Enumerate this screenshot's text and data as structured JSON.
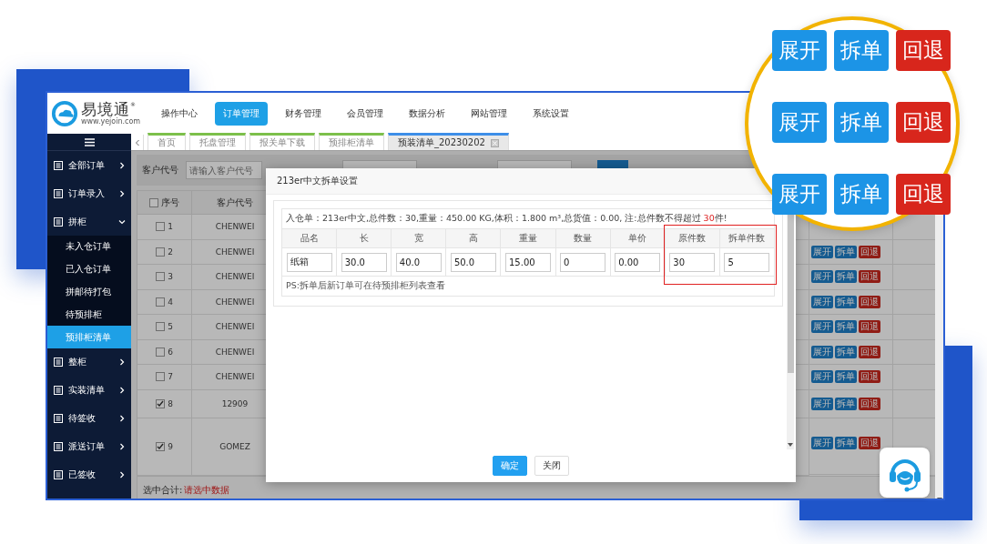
{
  "brand": {
    "name": "易境通",
    "mark": "®",
    "url": "www.yejoin.com"
  },
  "nav": [
    {
      "label": "操作中心",
      "selected": false
    },
    {
      "label": "订单管理",
      "selected": true
    },
    {
      "label": "财务管理",
      "selected": false
    },
    {
      "label": "会员管理",
      "selected": false
    },
    {
      "label": "数据分析",
      "selected": false
    },
    {
      "label": "网站管理",
      "selected": false
    },
    {
      "label": "系统设置",
      "selected": false
    }
  ],
  "sidebar": {
    "items": [
      {
        "label": "全部订单",
        "expanded": false
      },
      {
        "label": "订单录入",
        "expanded": false
      },
      {
        "label": "拼柜",
        "expanded": true,
        "children": [
          {
            "label": "未入仓订单",
            "selected": false
          },
          {
            "label": "已入仓订单",
            "selected": false
          },
          {
            "label": "拼邮待打包",
            "selected": false
          },
          {
            "label": "待预排柜",
            "selected": false
          },
          {
            "label": "预排柜清单",
            "selected": true
          }
        ]
      },
      {
        "label": "整柜",
        "expanded": false
      },
      {
        "label": "实装清单",
        "expanded": false
      },
      {
        "label": "待签收",
        "expanded": false
      },
      {
        "label": "派送订单",
        "expanded": false
      },
      {
        "label": "已签收",
        "expanded": false
      }
    ]
  },
  "tabs": [
    {
      "label": "首页",
      "selected": false,
      "closable": false
    },
    {
      "label": "托盘管理",
      "selected": false,
      "closable": false
    },
    {
      "label": "报关单下载",
      "selected": false,
      "closable": false
    },
    {
      "label": "预排柜清单",
      "selected": false,
      "closable": false
    },
    {
      "label": "预装清单_20230202",
      "selected": true,
      "closable": true
    }
  ],
  "filter": {
    "label": "客户代号",
    "placeholder": "请输入客户代号"
  },
  "table": {
    "columns": [
      "序号",
      "客户代号"
    ],
    "all_checked": false,
    "rows": [
      {
        "index": "1",
        "customer": "CHENWEI",
        "checked": false
      },
      {
        "index": "2",
        "customer": "CHENWEI",
        "checked": false,
        "actions": [
          {
            "label": "展开",
            "kind": "primary"
          },
          {
            "label": "拆单",
            "kind": "primary"
          },
          {
            "label": "回退",
            "kind": "danger"
          }
        ]
      },
      {
        "index": "3",
        "customer": "CHENWEI",
        "checked": false,
        "actions": [
          {
            "label": "展开",
            "kind": "primary"
          },
          {
            "label": "拆单",
            "kind": "primary"
          },
          {
            "label": "回退",
            "kind": "danger"
          }
        ]
      },
      {
        "index": "4",
        "customer": "CHENWEI",
        "checked": false,
        "actions": [
          {
            "label": "展开",
            "kind": "primary"
          },
          {
            "label": "拆单",
            "kind": "primary"
          },
          {
            "label": "回退",
            "kind": "danger"
          }
        ]
      },
      {
        "index": "5",
        "customer": "CHENWEI",
        "checked": false,
        "actions": [
          {
            "label": "展开",
            "kind": "primary"
          },
          {
            "label": "拆单",
            "kind": "primary"
          },
          {
            "label": "回退",
            "kind": "danger"
          }
        ]
      },
      {
        "index": "6",
        "customer": "CHENWEI",
        "checked": false,
        "actions": [
          {
            "label": "展开",
            "kind": "primary"
          },
          {
            "label": "拆单",
            "kind": "primary"
          },
          {
            "label": "回退",
            "kind": "danger"
          }
        ]
      },
      {
        "index": "7",
        "customer": "CHENWEI",
        "checked": false,
        "actions": [
          {
            "label": "展开",
            "kind": "primary"
          },
          {
            "label": "拆单",
            "kind": "primary"
          },
          {
            "label": "回退",
            "kind": "danger"
          }
        ]
      },
      {
        "index": "8",
        "customer": "12909",
        "checked": true,
        "actions": [
          {
            "label": "展开",
            "kind": "primary"
          },
          {
            "label": "拆单",
            "kind": "primary"
          },
          {
            "label": "回退",
            "kind": "danger"
          }
        ]
      },
      {
        "index": "9",
        "customer": "GOMEZ",
        "checked": true,
        "actions": [
          {
            "label": "展开",
            "kind": "primary"
          },
          {
            "label": "拆单",
            "kind": "primary"
          },
          {
            "label": "回退",
            "kind": "danger"
          }
        ]
      }
    ]
  },
  "summary": {
    "label": "选中合计:",
    "value": "请选中数据"
  },
  "modal": {
    "title": "213er中文拆单设置",
    "info": "入仓单：213er中文,总件数：30,重量：450.00 KG,体积：1.800 m³,总货值：0.00, 注:总件数不得超过 ",
    "limit": "30",
    "info_end": "件!",
    "fields": [
      {
        "label": "品名",
        "value": "纸箱",
        "highlighted": false
      },
      {
        "label": "长",
        "value": "30.0",
        "highlighted": false
      },
      {
        "label": "宽",
        "value": "40.0",
        "highlighted": false
      },
      {
        "label": "高",
        "value": "50.0",
        "highlighted": false
      },
      {
        "label": "重量",
        "value": "15.00",
        "highlighted": false
      },
      {
        "label": "数量",
        "value": "0",
        "highlighted": false
      },
      {
        "label": "单价",
        "value": "0.00",
        "highlighted": false
      },
      {
        "label": "原件数",
        "value": "30",
        "highlighted": true
      },
      {
        "label": "拆单件数",
        "value": "5",
        "highlighted": true
      }
    ],
    "note": "PS:拆单后新订单可在待预排柜列表查看",
    "buttons": [
      {
        "label": "确定",
        "kind": "primary"
      },
      {
        "label": "关闭",
        "kind": "default"
      }
    ]
  },
  "magnifier": {
    "rows": [
      [
        {
          "label": "展开",
          "kind": "primary"
        },
        {
          "label": "拆单",
          "kind": "primary"
        },
        {
          "label": "回退",
          "kind": "danger"
        }
      ],
      [
        {
          "label": "展开",
          "kind": "primary"
        },
        {
          "label": "拆单",
          "kind": "primary"
        },
        {
          "label": "回退",
          "kind": "danger"
        }
      ],
      [
        {
          "label": "展开",
          "kind": "primary"
        },
        {
          "label": "拆单",
          "kind": "primary"
        },
        {
          "label": "回退",
          "kind": "danger"
        }
      ]
    ]
  }
}
